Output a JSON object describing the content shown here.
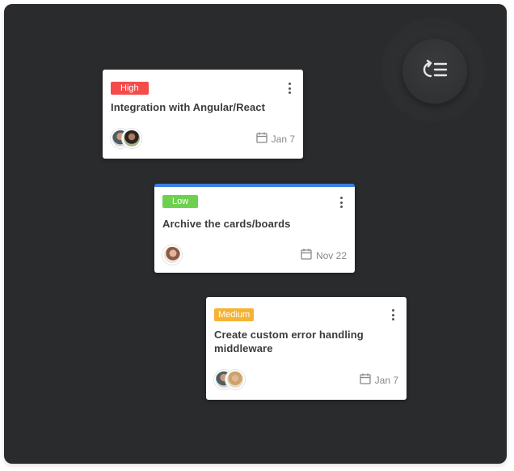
{
  "colors": {
    "panel_bg": "#2a2b2d",
    "high": "#f44b4b",
    "low": "#6dd14f",
    "medium": "#f5b335",
    "accent_top": "#3c7de0"
  },
  "fab": {
    "icon": "refresh-list-icon"
  },
  "cards": [
    {
      "priority": "High",
      "title": "Integration with Angular/React",
      "due": "Jan 7",
      "avatars": 2
    },
    {
      "priority": "Low",
      "title": "Archive the cards/boards",
      "due": "Nov 22",
      "avatars": 1
    },
    {
      "priority": "Medium",
      "title": "Create custom error handling middleware",
      "due": "Jan 7",
      "avatars": 2
    }
  ]
}
